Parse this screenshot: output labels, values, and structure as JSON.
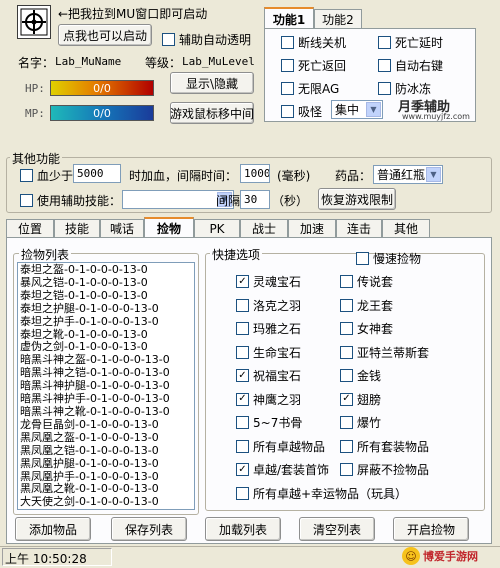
{
  "header": {
    "drag_hint": "←把我拉到MU窗口即可启动",
    "click_start_button": "点我也可以启动",
    "aux_transparent_label": "辅助自动透明",
    "name_label": "名字：",
    "name_value": "Lab_MuName",
    "level_label": "等级：",
    "level_value": "Lab_MuLevel",
    "show_hide_button": "显示\\隐藏",
    "mouse_center_button": "游戏鼠标移中间",
    "hp_label": "HP:",
    "hp_value": "0/0",
    "mp_label": "MP:",
    "mp_value": "0/0"
  },
  "function_tabs": [
    "功能1",
    "功能2"
  ],
  "function1_options": [
    {
      "label": "断线关机",
      "checked": false
    },
    {
      "label": "死亡延时",
      "checked": false
    },
    {
      "label": "死亡返回",
      "checked": false
    },
    {
      "label": "自动右键",
      "checked": false
    },
    {
      "label": "无限AG",
      "checked": false
    },
    {
      "label": "防冰冻",
      "checked": false
    }
  ],
  "absorb": {
    "label": "吸怪",
    "checked": false,
    "select_value": "集中"
  },
  "watermark": {
    "brand": "月季辅助",
    "url": "www.muyjfz.com"
  },
  "other": {
    "title": "其他功能",
    "blood_label": "血少于",
    "blood_value": "5000",
    "timed_heal_label": "时加血，间隔时间：",
    "interval_value": "1000",
    "ms_label": "(毫秒)",
    "potion_label": "药品：",
    "potion_value": "普通红瓶",
    "use_skill_label": "使用辅助技能：",
    "skill_value": "",
    "gap_label": "间隔",
    "gap_value": "30",
    "sec_label": "（秒）",
    "restore_button": "恢复游戏限制"
  },
  "main_tabs": [
    "位置",
    "技能",
    "喊话",
    "捡物",
    "PK",
    "战士",
    "加速",
    "连击",
    "其他"
  ],
  "active_tab": "捡物",
  "pick_list": {
    "title": "捡物列表",
    "items": [
      "泰坦之盔-0-1-0-0-0-13-0",
      "暴风之铠-0-1-0-0-0-13-0",
      "泰坦之铠-0-1-0-0-0-13-0",
      "泰坦之护腿-0-1-0-0-0-13-0",
      "泰坦之护手-0-1-0-0-0-13-0",
      "泰坦之靴-0-1-0-0-0-13-0",
      "虚伪之剑-0-1-0-0-0-13-0",
      "暗黑斗神之盔-0-1-0-0-0-13-0",
      "暗黑斗神之铠-0-1-0-0-0-13-0",
      "暗黑斗神护腿-0-1-0-0-0-13-0",
      "暗黑斗神护手-0-1-0-0-0-13-0",
      "暗黑斗神之靴-0-1-0-0-0-13-0",
      "龙骨巨晶剑-0-1-0-0-0-13-0",
      "黑凤凰之盔-0-1-0-0-0-13-0",
      "黑凤凰之铠-0-1-0-0-0-13-0",
      "黑凤凰护腿-0-1-0-0-0-13-0",
      "黑凤凰护手-0-1-0-0-0-13-0",
      "黑凤凰之靴-0-1-0-0-0-13-0",
      "大天使之剑-0-1-0-0-0-13-0"
    ]
  },
  "quick": {
    "title": "快捷选项",
    "slow_pick": {
      "label": "慢速捡物",
      "checked": false
    },
    "left": [
      {
        "label": "灵魂宝石",
        "checked": true
      },
      {
        "label": "洛克之羽",
        "checked": false
      },
      {
        "label": "玛雅之石",
        "checked": false
      },
      {
        "label": "生命宝石",
        "checked": false
      },
      {
        "label": "祝福宝石",
        "checked": true
      },
      {
        "label": "神鹰之羽",
        "checked": true
      },
      {
        "label": "5~7书骨",
        "checked": false
      },
      {
        "label": "所有卓越物品",
        "checked": false
      },
      {
        "label": "卓越/套装首饰",
        "checked": true
      }
    ],
    "right": [
      {
        "label": "传说套",
        "checked": false
      },
      {
        "label": "龙王套",
        "checked": false
      },
      {
        "label": "女神套",
        "checked": false
      },
      {
        "label": "亚特兰蒂斯套",
        "checked": false
      },
      {
        "label": "金钱",
        "checked": false
      },
      {
        "label": "翅膀",
        "checked": true
      },
      {
        "label": "爆竹",
        "checked": false
      },
      {
        "label": "所有套装物品",
        "checked": false
      },
      {
        "label": "屏蔽不捡物品",
        "checked": false
      }
    ],
    "bottom": {
      "label": "所有卓越+幸运物品（玩具）",
      "checked": false
    }
  },
  "actions": [
    "添加物品",
    "保存列表",
    "加载列表",
    "清空列表",
    "开启捡物"
  ],
  "status": {
    "time": "上午 10:50:28",
    "corner_brand": "博爱手游网"
  }
}
